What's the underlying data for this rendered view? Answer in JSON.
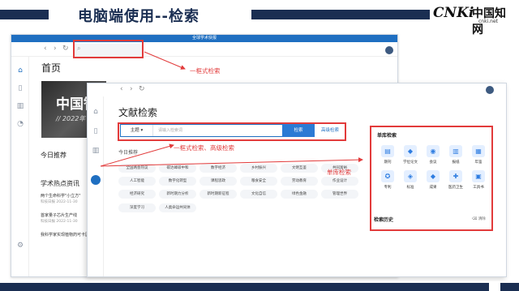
{
  "slide": {
    "title": "电脑端使用--检索",
    "logo": {
      "mark": "CNKi",
      "cn": "中国知网",
      "url": "cnki.net"
    },
    "page_number": ""
  },
  "back_window": {
    "title": "全球学术快报",
    "nav": {
      "back": "‹",
      "forward": "›",
      "refresh": "↻"
    },
    "home_title": "首页",
    "banner": {
      "big": "中国智",
      "year": "// 2022年"
    },
    "today_recommend": "今日推荐",
    "hot_title": "学术热点资讯",
    "hot_items": [
      {
        "title": "两个生命科学\"小立方\"",
        "source": "科技日报 2022-11-30"
      },
      {
        "title": "首家量子芯片生产线",
        "source": "科技日报 2022-11-30"
      },
      {
        "title": "我科学家实现植物药可卡因的从头生物合成",
        "source": ""
      }
    ]
  },
  "front_window": {
    "title": "文献检索",
    "nav": {
      "back": "‹",
      "forward": "›",
      "refresh": "↻"
    },
    "search": {
      "field": "主题",
      "field_caret": "▾",
      "placeholder": "请输入检索词",
      "button": "检索",
      "advanced": "高级检索"
    },
    "recommend_title": "今日推荐",
    "tags": [
      "全国两会热议",
      "碳达峰碳中和",
      "数字经济",
      "乡村振兴",
      "文明互鉴",
      "共同富裕",
      "人工智能",
      "数字化转型",
      "课程思政",
      "粮食安全",
      "劳动教育",
      "作业设计",
      "经济研究",
      "新时期力分析",
      "新时期新征程",
      "文化自信",
      "绿色金融",
      "管理世界",
      "深度学习",
      "人类命运共同体"
    ],
    "single_db": {
      "title": "单库检索",
      "items": [
        {
          "label": "期刊",
          "icon": "journal-icon",
          "glyph": "▤"
        },
        {
          "label": "学位论文",
          "icon": "graduation-cap-icon",
          "glyph": "◆"
        },
        {
          "label": "会议",
          "icon": "meeting-icon",
          "glyph": "◉"
        },
        {
          "label": "报纸",
          "icon": "newspaper-icon",
          "glyph": "▥"
        },
        {
          "label": "年鉴",
          "icon": "yearbook-icon",
          "glyph": "▦"
        },
        {
          "label": "专利",
          "icon": "patent-icon",
          "glyph": "✪"
        },
        {
          "label": "标准",
          "icon": "standard-icon",
          "glyph": "◈"
        },
        {
          "label": "成果",
          "icon": "achievement-icon",
          "glyph": "◆"
        },
        {
          "label": "医药卫生",
          "icon": "medicine-icon",
          "glyph": "✚"
        },
        {
          "label": "工具书",
          "icon": "reference-book-icon",
          "glyph": "▣"
        }
      ]
    },
    "history": {
      "title": "检索历史",
      "clear": "清除",
      "clear_icon": "⌫"
    }
  },
  "annotations": {
    "one_box_search": "一框式检索",
    "one_box_advanced": "一框式检索、高级检索",
    "single_db_search": "单库检索",
    "color": "#e23b3b"
  }
}
